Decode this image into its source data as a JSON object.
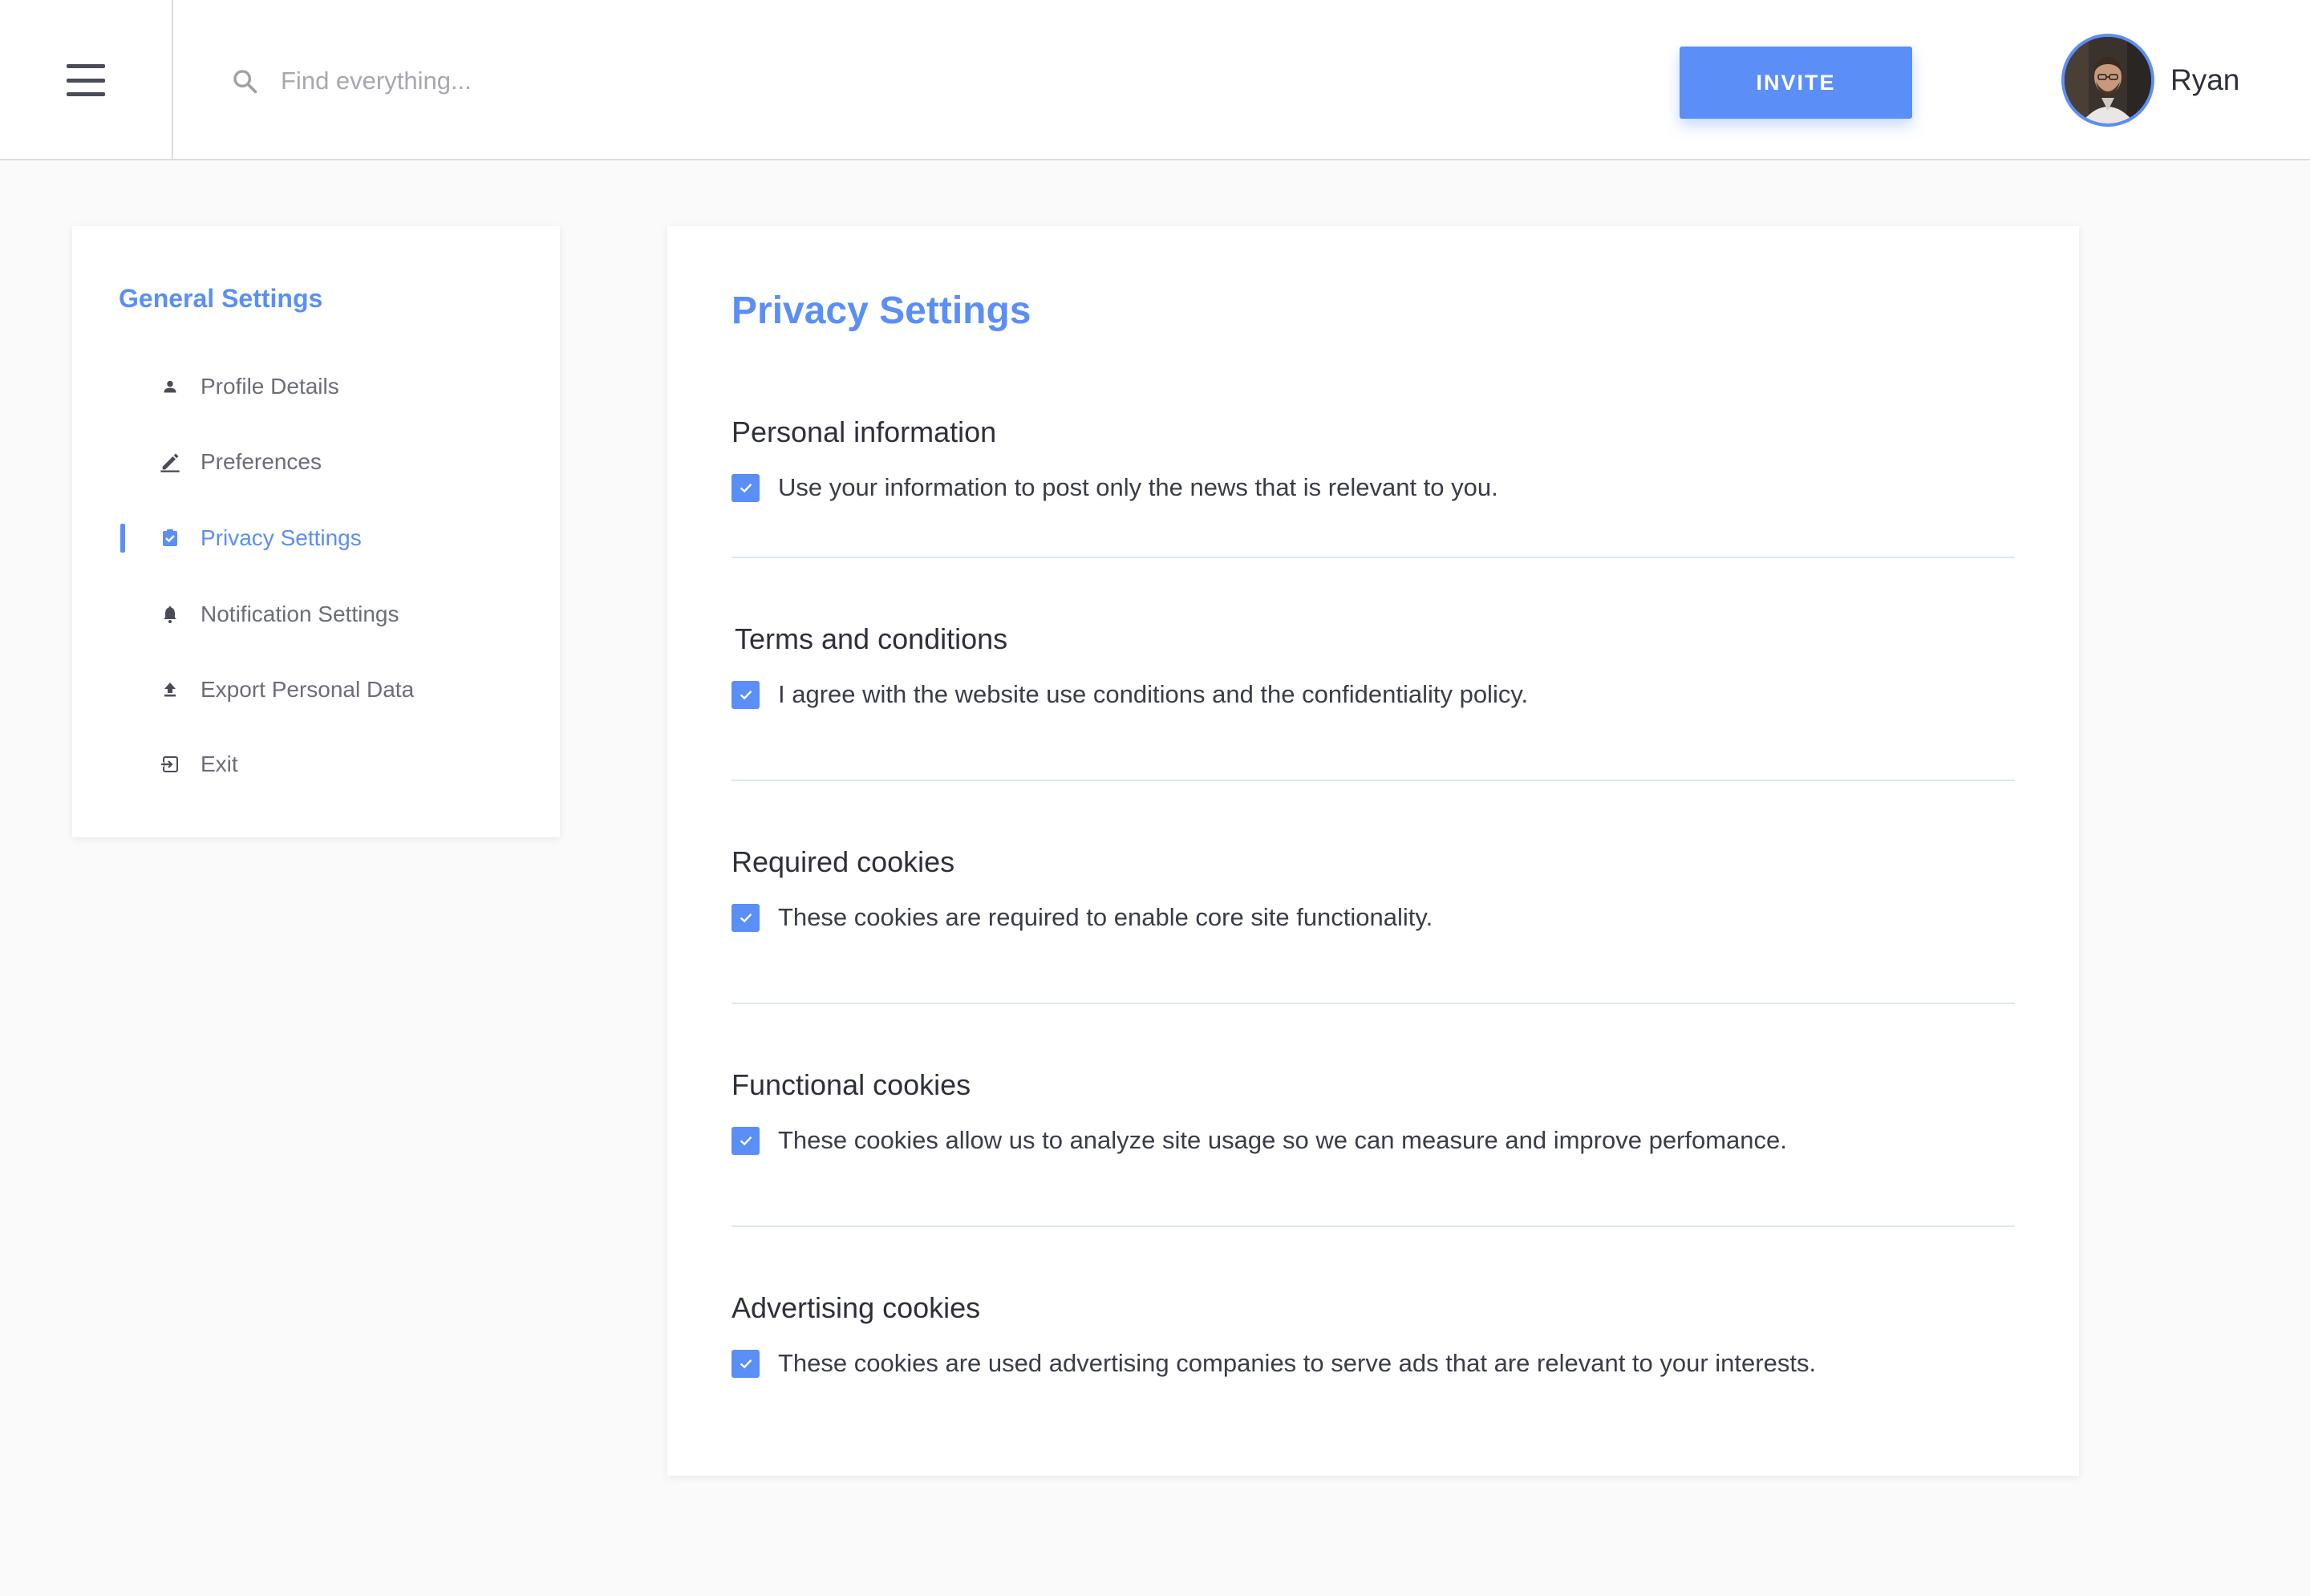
{
  "header": {
    "search_placeholder": "Find everything...",
    "invite_label": "INVITE",
    "user_name": "Ryan"
  },
  "sidebar": {
    "title": "General Settings",
    "items": [
      {
        "label": "Profile Details",
        "icon": "person-icon",
        "active": false
      },
      {
        "label": "Preferences",
        "icon": "pencil-icon",
        "active": false
      },
      {
        "label": "Privacy Settings",
        "icon": "shield-check-icon",
        "active": true
      },
      {
        "label": "Notification Settings",
        "icon": "bell-icon",
        "active": false
      },
      {
        "label": "Export Personal Data",
        "icon": "upload-icon",
        "active": false
      },
      {
        "label": "Exit",
        "icon": "exit-icon",
        "active": false
      }
    ]
  },
  "main": {
    "title": "Privacy Settings",
    "sections": [
      {
        "heading": "Personal information",
        "text": "Use your information to post only the news that is relevant to you.",
        "checked": true
      },
      {
        "heading": "Terms and conditions",
        "text": "I agree with the website use conditions and the confidentiality policy.",
        "checked": true
      },
      {
        "heading": "Required cookies",
        "text": "These cookies are required to enable core site functionality.",
        "checked": true
      },
      {
        "heading": "Functional cookies",
        "text": "These cookies allow us to analyze site usage so we can measure and improve perfomance.",
        "checked": true
      },
      {
        "heading": "Advertising cookies",
        "text": "These cookies are used advertising companies to serve ads that are relevant to your interests.",
        "checked": true
      }
    ]
  },
  "colors": {
    "accent": "#5b8ef7",
    "background": "#fafafa",
    "text": "#333642"
  }
}
